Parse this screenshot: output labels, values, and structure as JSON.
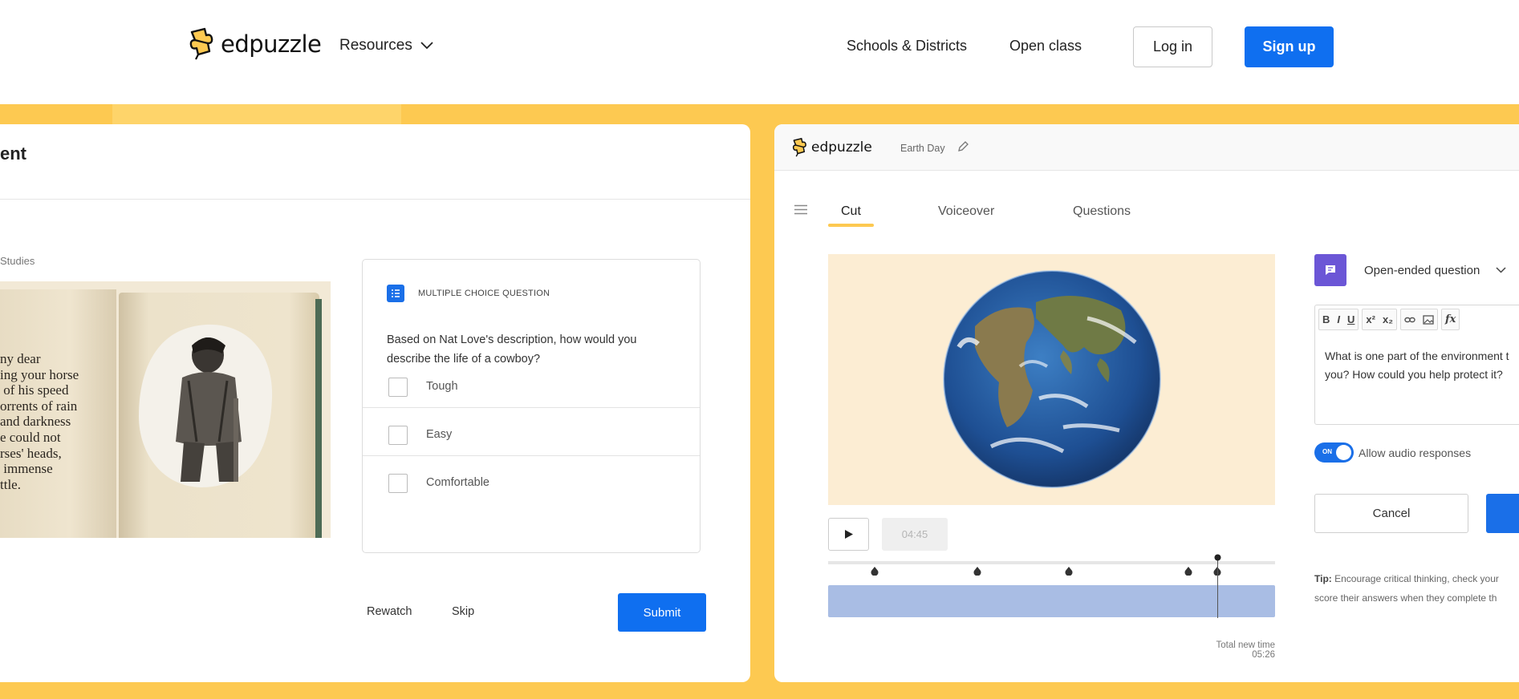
{
  "nav": {
    "logo_text": "edpuzzle",
    "resources": "Resources",
    "schools": "Schools & Districts",
    "open_class": "Open class",
    "login": "Log in",
    "signup": "Sign up"
  },
  "student": {
    "title": "ent",
    "subject": "Studies",
    "book_text": "ny dear\ning your horse\n of his speed\norrents of rain\nand darkness\ne could not\nrses' heads,\n immense\nttle.",
    "question_type": "MULTIPLE CHOICE QUESTION",
    "question": "Based on Nat Love's description, how would you describe the life of a cowboy?",
    "options": [
      "Tough",
      "Easy",
      "Comfortable"
    ],
    "rewatch": "Rewatch",
    "skip": "Skip",
    "submit": "Submit"
  },
  "editor": {
    "logo_text": "edpuzzle",
    "doc_title": "Earth Day",
    "tabs": [
      "Cut",
      "Voiceover",
      "Questions"
    ],
    "active_tab": "Cut",
    "time": "04:45",
    "total_time": "Total new time 05:26",
    "question_type": "Open-ended question",
    "toolbar": {
      "bold": "B",
      "italic": "I",
      "underline": "U",
      "superscript": "x²",
      "subscript": "x₂",
      "formula": "fx"
    },
    "question_text": "What is one part of the environment t\nyou? How could you help protect it?",
    "toggle_on": "ON",
    "toggle_label": "Allow audio responses",
    "cancel": "Cancel",
    "tip_label": "Tip:",
    "tip_text": " Encourage critical thinking, check your\nscore their answers when they complete th"
  },
  "colors": {
    "brand_yellow": "#fdc951",
    "primary_blue": "#0f6ff0",
    "question_purple": "#6b56d6",
    "timeline_blue": "#a9bde4"
  }
}
